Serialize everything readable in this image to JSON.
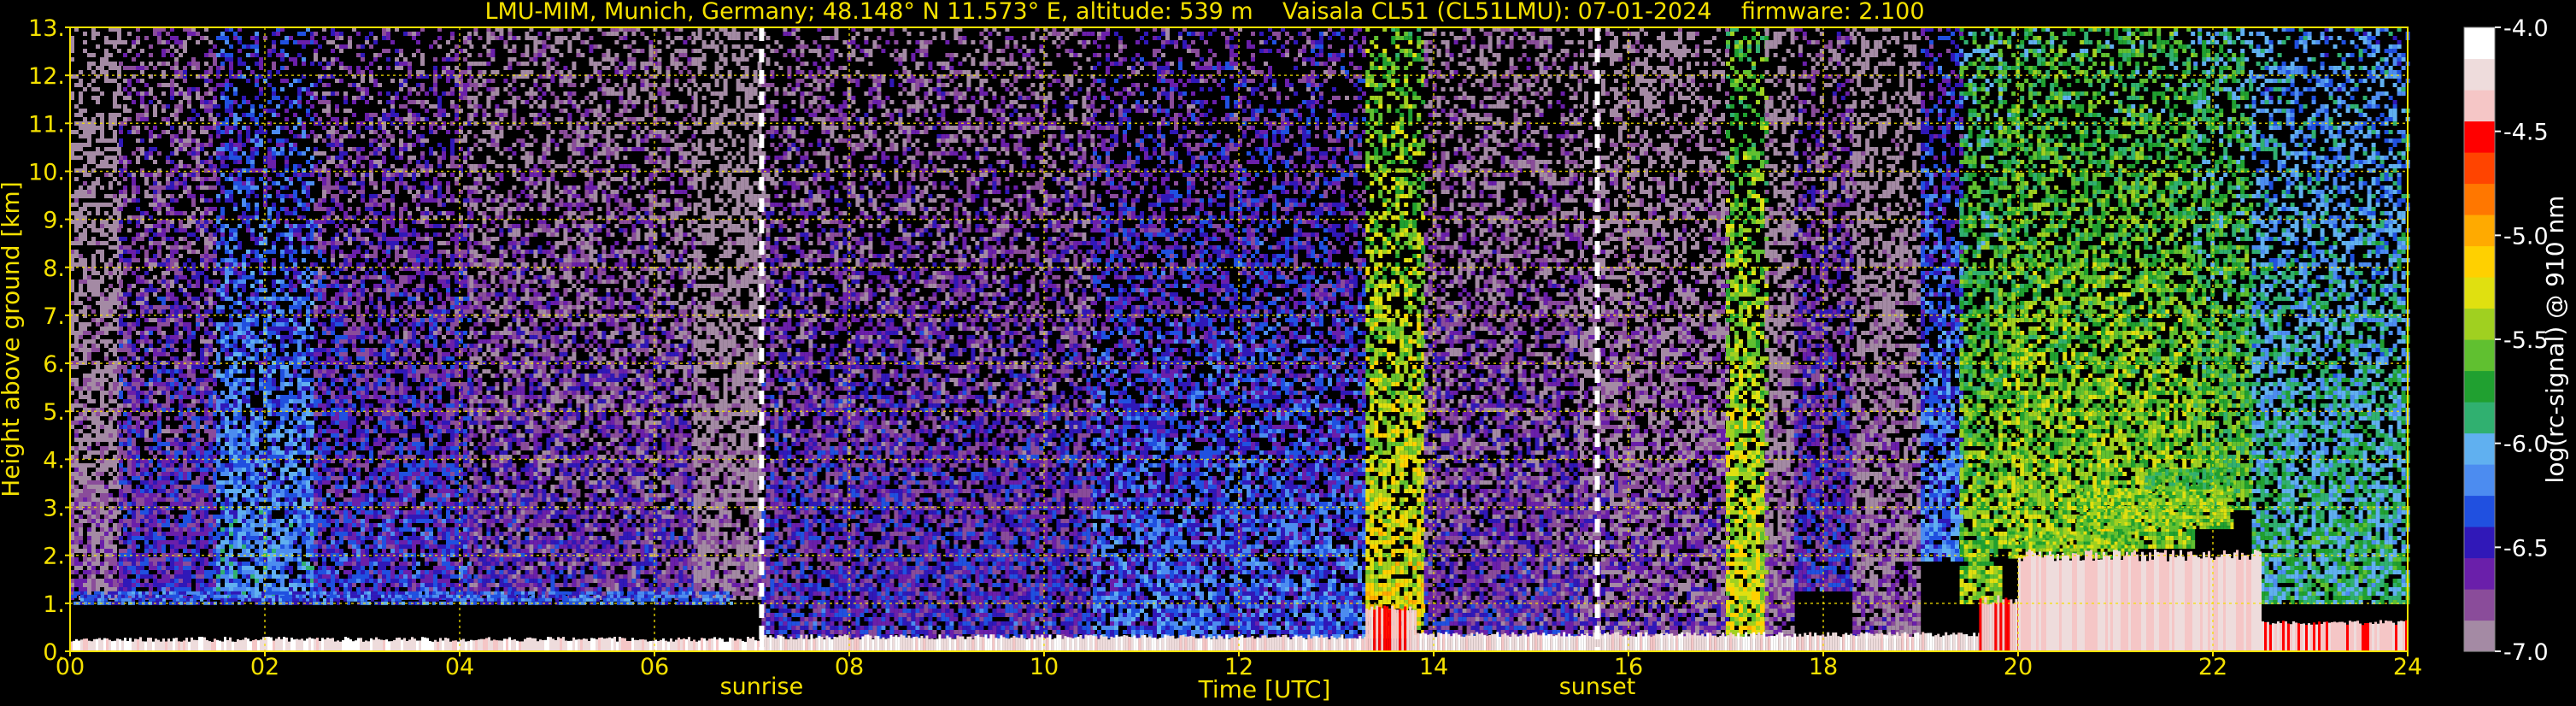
{
  "chart_data": {
    "type": "heatmap",
    "title": "LMU-MIM, Munich, Germany; 48.148° N 11.573° E, altitude: 539 m    Vaisala CL51 (CL51LMU): 07-01-2024    firmware: 2.100",
    "xlabel": "Time [UTC]",
    "ylabel": "Height above ground [km]",
    "xlim": [
      0,
      24
    ],
    "ylim": [
      0,
      13
    ],
    "x_ticks": [
      "00",
      "02",
      "04",
      "06",
      "08",
      "10",
      "12",
      "14",
      "16",
      "18",
      "20",
      "22",
      "24"
    ],
    "y_ticks": [
      "0.",
      "1.",
      "2.",
      "3.",
      "4.",
      "5.",
      "6.",
      "7.",
      "8.",
      "9.",
      "10.",
      "11.",
      "12.",
      "13."
    ],
    "grid": true,
    "events": [
      {
        "label": "sunrise",
        "time": 7.1
      },
      {
        "label": "sunset",
        "time": 15.68
      }
    ],
    "colorbar": {
      "label": "log(rc-signal) @ 910 nm",
      "range": [
        -7.0,
        -4.0
      ],
      "ticks": [
        "-4.0",
        "-4.5",
        "-5.0",
        "-5.5",
        "-6.0",
        "-6.5",
        "-7.0"
      ],
      "colors_low_to_high": [
        "#a48aa4",
        "#8a4c9a",
        "#6a1faa",
        "#3018b8",
        "#2050e0",
        "#4c8cf0",
        "#60b0f0",
        "#30b070",
        "#20a030",
        "#60c030",
        "#a0d020",
        "#e0e010",
        "#ffd000",
        "#ffaa00",
        "#ff7700",
        "#ff4400",
        "#ff0000",
        "#f5c6c6",
        "#eedcdc",
        "#ffffff"
      ]
    },
    "profile_regions": [
      {
        "t0": 0.0,
        "t1": 0.5,
        "base_km": 1.1,
        "top_km": 13.0,
        "value": -6.85
      },
      {
        "t0": 0.5,
        "t1": 1.5,
        "base_km": 1.1,
        "top_km": 13.0,
        "value": -6.5
      },
      {
        "t0": 1.5,
        "t1": 2.5,
        "base_km": 1.1,
        "top_km": 13.0,
        "value": -6.15
      },
      {
        "t0": 2.5,
        "t1": 4.1,
        "base_km": 1.1,
        "top_km": 13.0,
        "value": -6.45
      },
      {
        "t0": 4.1,
        "t1": 6.4,
        "base_km": 1.1,
        "top_km": 13.0,
        "value": -6.6
      },
      {
        "t0": 6.4,
        "t1": 7.1,
        "base_km": 1.1,
        "top_km": 13.0,
        "value": -6.9
      },
      {
        "t0": 7.1,
        "t1": 10.5,
        "base_km": 0.3,
        "top_km": 13.0,
        "value": -6.5
      },
      {
        "t0": 10.5,
        "t1": 13.3,
        "base_km": 0.3,
        "top_km": 13.0,
        "value": -6.3
      },
      {
        "t0": 13.3,
        "t1": 13.9,
        "base_km": 0.3,
        "top_km": 13.0,
        "value": -5.25
      },
      {
        "t0": 13.9,
        "t1": 15.5,
        "base_km": 0.3,
        "top_km": 13.0,
        "value": -6.6
      },
      {
        "t0": 15.5,
        "t1": 17.0,
        "base_km": 0.3,
        "top_km": 13.0,
        "value": -6.7
      },
      {
        "t0": 17.0,
        "t1": 17.4,
        "base_km": 0.3,
        "top_km": 13.0,
        "value": -5.3
      },
      {
        "t0": 17.4,
        "t1": 17.7,
        "base_km": 0.3,
        "top_km": 13.0,
        "value": -6.8
      },
      {
        "t0": 17.7,
        "t1": 18.3,
        "base_km": 1.3,
        "top_km": 13.0,
        "value": -6.5
      },
      {
        "t0": 18.3,
        "t1": 19.0,
        "base_km": 0.3,
        "top_km": 13.0,
        "value": -6.8
      },
      {
        "t0": 19.0,
        "t1": 19.4,
        "base_km": 1.9,
        "top_km": 13.0,
        "value": -6.2
      },
      {
        "t0": 19.4,
        "t1": 19.8,
        "base_km": 1.0,
        "top_km": 13.0,
        "value": -5.5
      },
      {
        "t0": 19.8,
        "t1": 21.8,
        "base_km": 2.2,
        "top_km": 13.0,
        "value": -5.45
      },
      {
        "t0": 21.8,
        "t1": 22.4,
        "base_km": 3.0,
        "top_km": 13.0,
        "value": -5.6
      },
      {
        "t0": 22.4,
        "t1": 24.0,
        "base_km": 1.0,
        "top_km": 13.0,
        "value": -5.85
      }
    ],
    "ground_layer": [
      {
        "t0": 0.0,
        "t1": 7.1,
        "top_km": 0.25,
        "value": -4.2
      },
      {
        "t0": 7.1,
        "t1": 13.3,
        "top_km": 0.3,
        "value": -4.2
      },
      {
        "t0": 13.3,
        "t1": 13.8,
        "top_km": 0.9,
        "value": -4.4
      },
      {
        "t0": 13.8,
        "t1": 19.6,
        "top_km": 0.35,
        "value": -4.2
      },
      {
        "t0": 19.6,
        "t1": 20.0,
        "top_km": 1.1,
        "value": -4.4
      },
      {
        "t0": 20.0,
        "t1": 22.5,
        "top_km": 2.0,
        "value": -4.3
      },
      {
        "t0": 22.5,
        "t1": 24.0,
        "top_km": 0.6,
        "value": -4.4
      }
    ],
    "boundary_layer_aerosol": [
      {
        "t0": 0.0,
        "t1": 6.8,
        "base_km": 1.0,
        "top_km": 1.25,
        "value": -6.3
      },
      {
        "t0": 19.9,
        "t1": 21.2,
        "base_km": 2.0,
        "top_km": 2.5,
        "value": -5.5
      },
      {
        "t0": 20.6,
        "t1": 22.2,
        "base_km": 2.6,
        "top_km": 3.4,
        "value": -5.5
      },
      {
        "t0": 21.3,
        "t1": 22.2,
        "base_km": 3.4,
        "top_km": 3.8,
        "value": -5.7
      }
    ]
  }
}
